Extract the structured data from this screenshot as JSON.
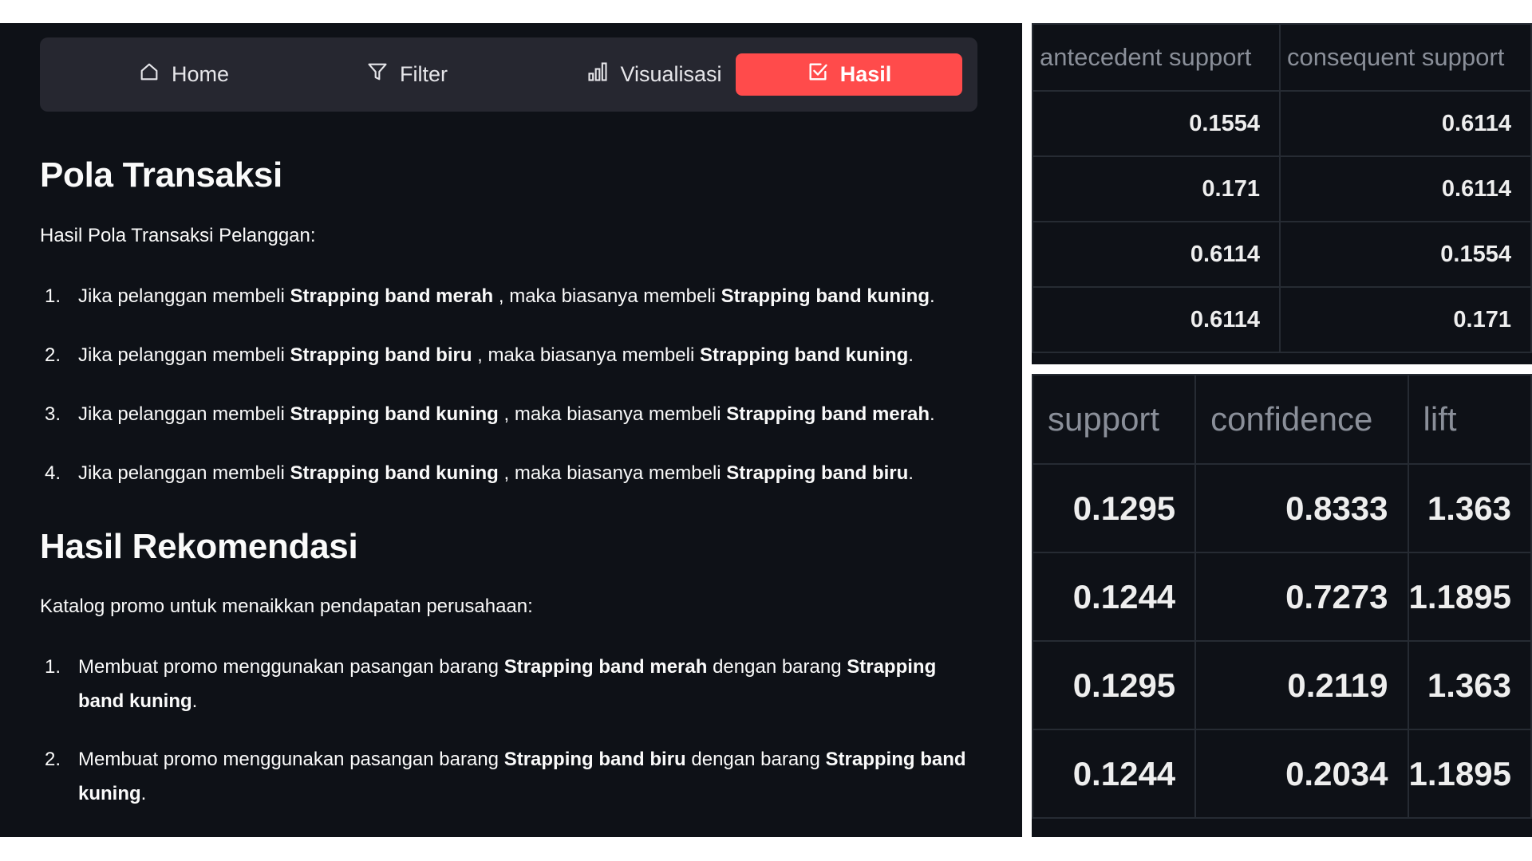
{
  "nav": {
    "items": [
      {
        "label": "Home",
        "icon": "home-icon"
      },
      {
        "label": "Filter",
        "icon": "filter-icon"
      },
      {
        "label": "Visualisasi",
        "icon": "bar-chart-icon"
      },
      {
        "label": "Hasil",
        "icon": "checkbox-icon",
        "active": true
      }
    ],
    "active_color": "#ff4b4b"
  },
  "pola": {
    "title": "Pola Transaksi",
    "intro": "Hasil Pola Transaksi Pelanggan:",
    "items": [
      {
        "num": "1.",
        "pre": "Jika pelanggan membeli ",
        "a": "Strapping band merah",
        "mid": " , maka biasanya membeli ",
        "b": "Strapping band kuning",
        "post": "."
      },
      {
        "num": "2.",
        "pre": "Jika pelanggan membeli ",
        "a": "Strapping band biru",
        "mid": " , maka biasanya membeli ",
        "b": "Strapping band kuning",
        "post": "."
      },
      {
        "num": "3.",
        "pre": "Jika pelanggan membeli ",
        "a": "Strapping band kuning",
        "mid": " , maka biasanya membeli ",
        "b": "Strapping band merah",
        "post": "."
      },
      {
        "num": "4.",
        "pre": "Jika pelanggan membeli ",
        "a": "Strapping band kuning",
        "mid": " , maka biasanya membeli ",
        "b": "Strapping band biru",
        "post": "."
      }
    ]
  },
  "rekomendasi": {
    "title": "Hasil Rekomendasi",
    "intro": "Katalog promo untuk menaikkan pendapatan perusahaan:",
    "items": [
      {
        "num": "1.",
        "pre": "Membuat promo menggunakan pasangan barang ",
        "a": "Strapping band merah",
        "mid": " dengan barang ",
        "b": "Strapping band kuning",
        "post": "."
      },
      {
        "num": "2.",
        "pre": "Membuat promo menggunakan pasangan barang ",
        "a": "Strapping band biru",
        "mid": " dengan barang ",
        "b": "Strapping band kuning",
        "post": "."
      }
    ]
  },
  "table_support": {
    "headers": [
      "antecedent support",
      "consequent support"
    ],
    "rows": [
      [
        "0.1554",
        "0.6114"
      ],
      [
        "0.171",
        "0.6114"
      ],
      [
        "0.6114",
        "0.1554"
      ],
      [
        "0.6114",
        "0.171"
      ]
    ]
  },
  "table_metrics": {
    "headers": [
      "support",
      "confidence",
      "lift"
    ],
    "rows": [
      [
        "0.1295",
        "0.8333",
        "1.363"
      ],
      [
        "0.1244",
        "0.7273",
        "1.1895"
      ],
      [
        "0.1295",
        "0.2119",
        "1.363"
      ],
      [
        "0.1244",
        "0.2034",
        "1.1895"
      ]
    ]
  }
}
